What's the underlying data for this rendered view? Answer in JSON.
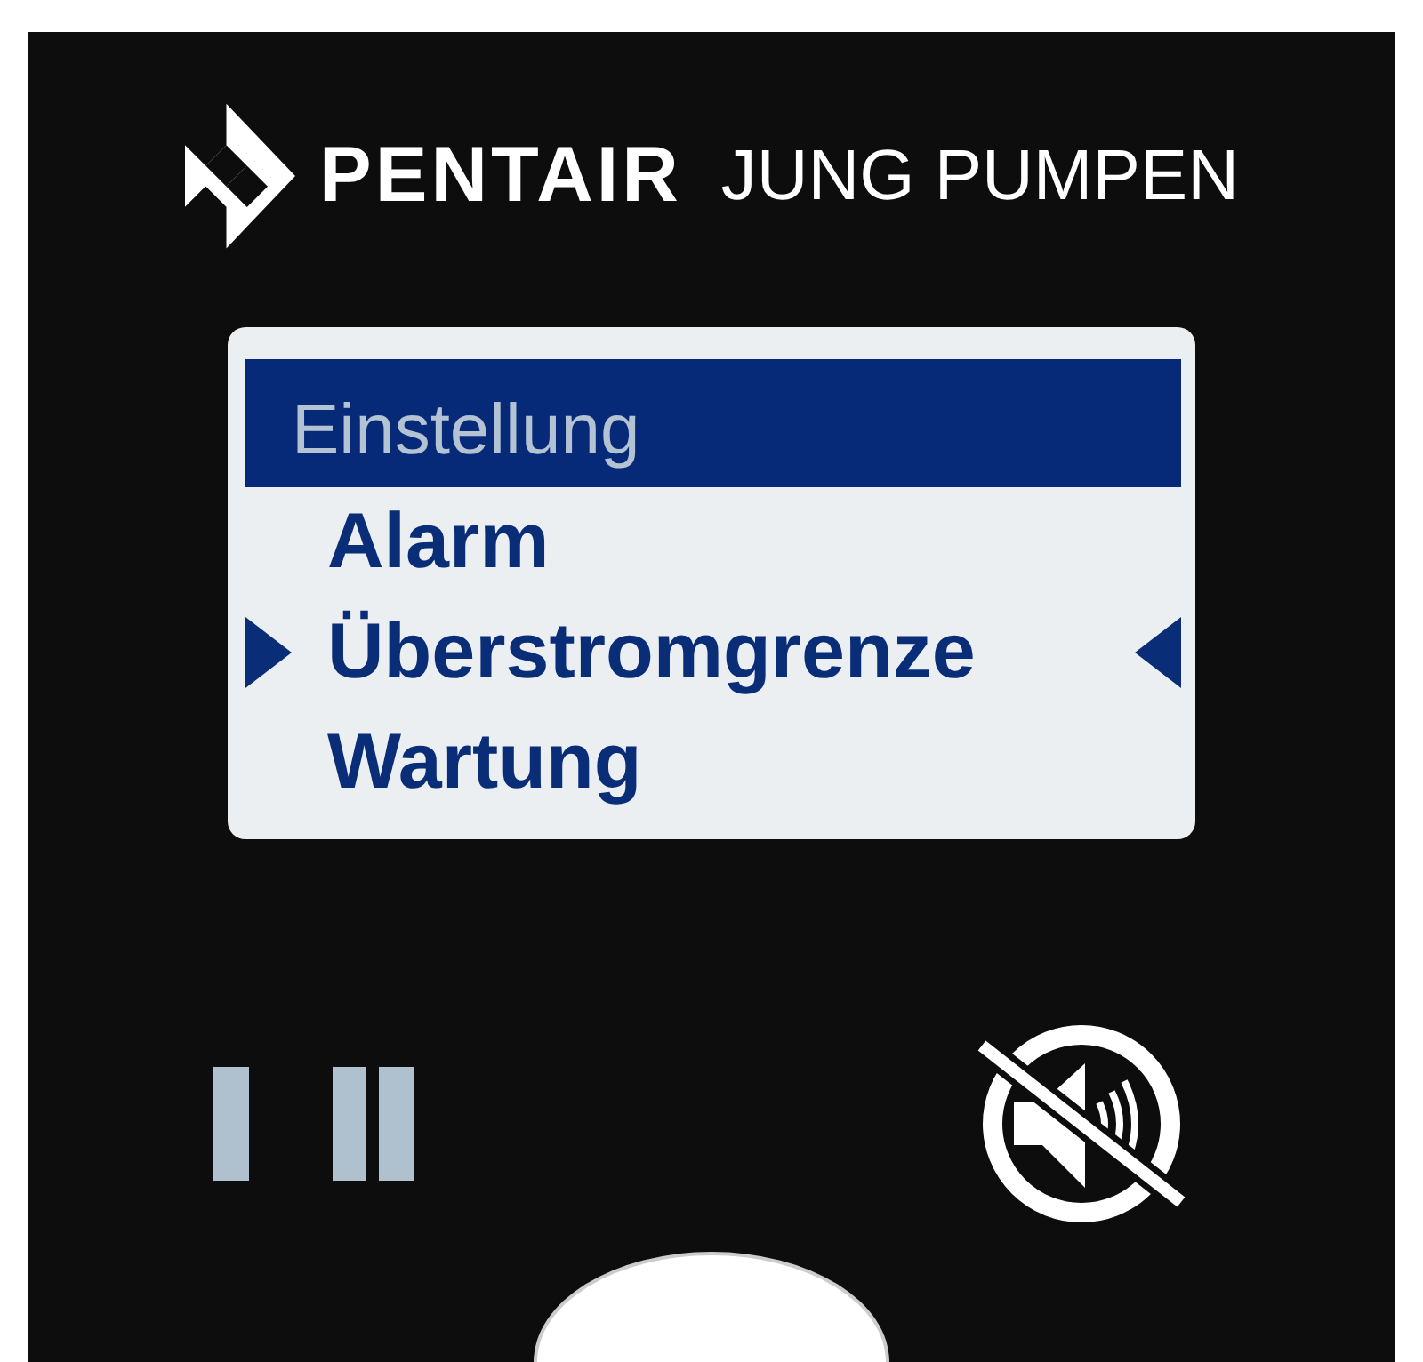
{
  "logo": {
    "brand": "PENTAIR",
    "subbrand": "JUNG PUMPEN"
  },
  "display": {
    "title": "Einstellung",
    "items": [
      {
        "label": "Alarm",
        "selected": false
      },
      {
        "label": "Überstromgrenze",
        "selected": true
      },
      {
        "label": "Wartung",
        "selected": false
      }
    ]
  },
  "controls": {
    "alarm_muted": true
  }
}
